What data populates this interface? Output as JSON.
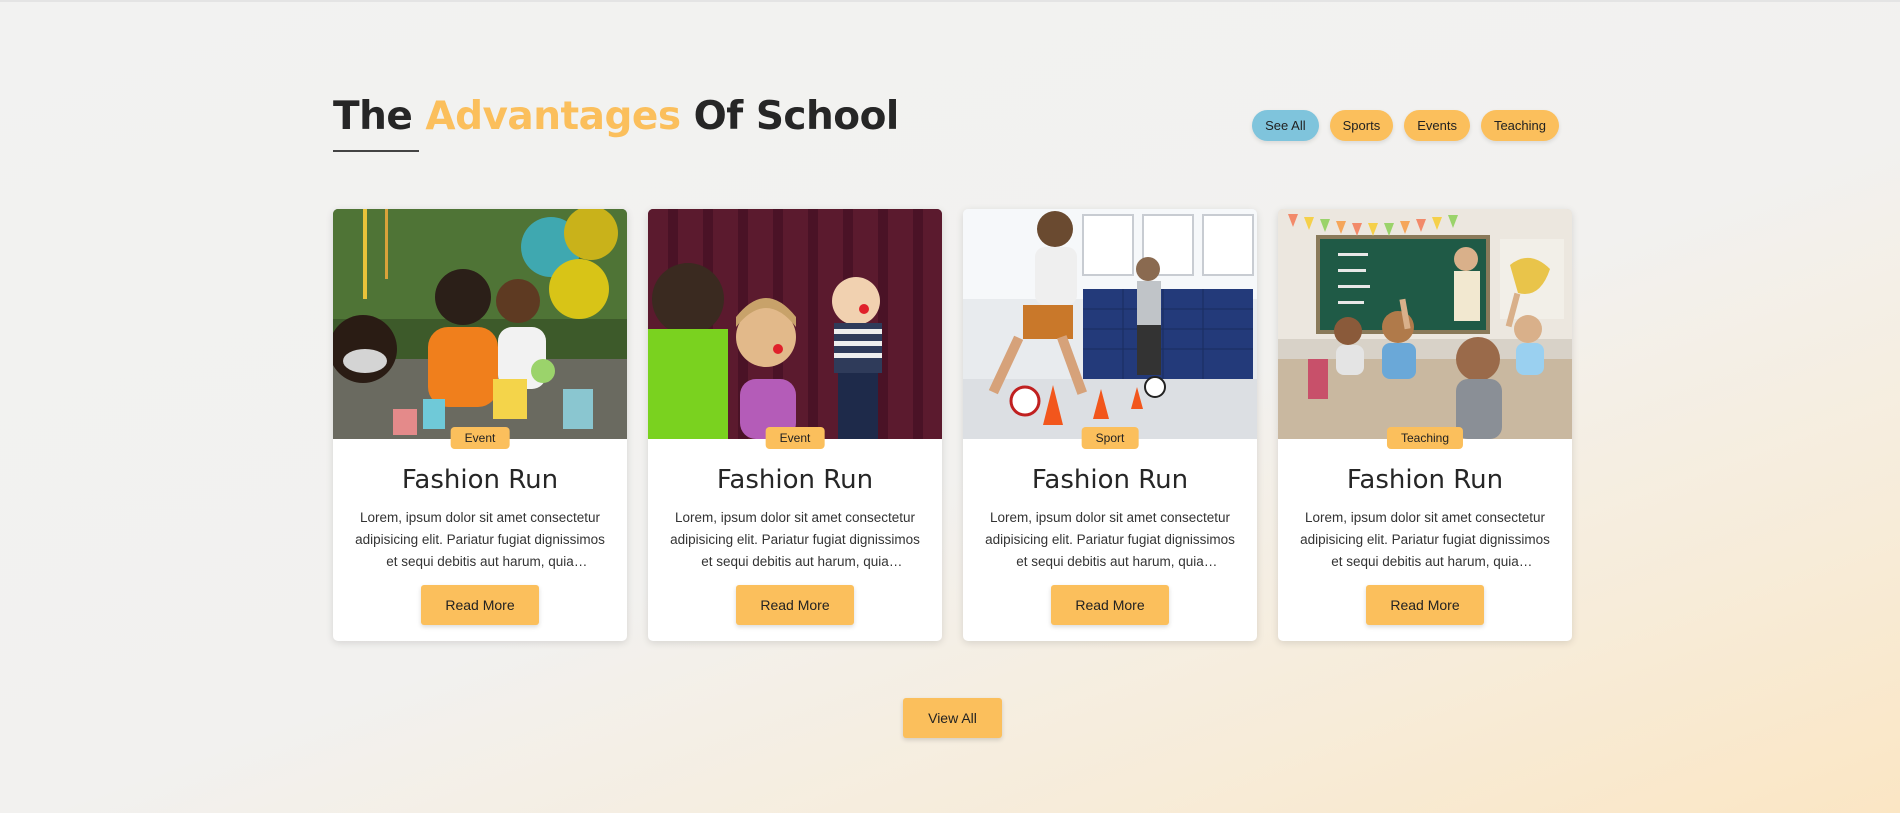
{
  "section": {
    "title_part1": "The ",
    "title_accent": "Advantages",
    "title_part2": " Of School",
    "accent_color": "#fbbf5c",
    "active_filter_color": "#7fc4dc"
  },
  "filters": [
    {
      "label": "See All",
      "active": true
    },
    {
      "label": "Sports",
      "active": false
    },
    {
      "label": "Events",
      "active": false
    },
    {
      "label": "Teaching",
      "active": false
    }
  ],
  "cards": [
    {
      "badge": "Event",
      "title": "Fashion Run",
      "text": "Lorem, ipsum dolor sit amet consectetur adipisicing elit. Pariatur fugiat dignissimos et sequi debitis aut harum, quia voluptatem.",
      "button": "Read More",
      "image": "kids-face-painting-party-photo"
    },
    {
      "badge": "Event",
      "title": "Fashion Run",
      "text": "Lorem, ipsum dolor sit amet consectetur adipisicing elit. Pariatur fugiat dignissimos et sequi debitis aut harum, quia voluptatem.",
      "button": "Read More",
      "image": "kids-stage-performance-photo"
    },
    {
      "badge": "Sport",
      "title": "Fashion Run",
      "text": "Lorem, ipsum dolor sit amet consectetur adipisicing elit. Pariatur fugiat dignissimos et sequi debitis aut harum, quia voluptatem.",
      "button": "Read More",
      "image": "kids-football-gym-photo"
    },
    {
      "badge": "Teaching",
      "title": "Fashion Run",
      "text": "Lorem, ipsum dolor sit amet consectetur adipisicing elit. Pariatur fugiat dignissimos et sequi debitis aut harum, quia voluptatem.",
      "button": "Read More",
      "image": "classroom-raised-hands-photo"
    }
  ],
  "view_all_label": "View All"
}
